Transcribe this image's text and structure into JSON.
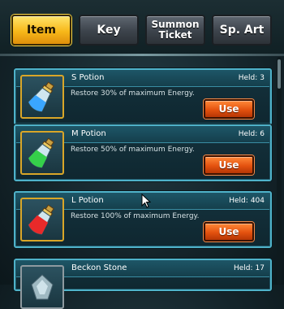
{
  "tabs": [
    {
      "label": "Item",
      "active": true
    },
    {
      "label": "Key",
      "active": false
    },
    {
      "label": "Summon Ticket",
      "active": false
    },
    {
      "label": "Sp. Art",
      "active": false
    }
  ],
  "held_label": "Held:",
  "items": [
    {
      "name": "S Potion",
      "held": "3",
      "description": "Restore 30% of maximum Energy.",
      "button": "Use",
      "icon": "blue-potion-icon",
      "liquid_color": "#3aa6ff"
    },
    {
      "name": "M Potion",
      "held": "6",
      "description": "Restore 50% of maximum Energy.",
      "button": "Use",
      "icon": "green-potion-icon",
      "liquid_color": "#35d04a"
    },
    {
      "name": "L Potion",
      "held": "404",
      "description": "Restore 100% of maximum Energy.",
      "button": "Use",
      "icon": "red-potion-icon",
      "liquid_color": "#e82a2a"
    },
    {
      "name": "Beckon Stone",
      "held": "17",
      "icon": "stone-icon"
    }
  ],
  "colors": {
    "active_tab": "#f7b81a",
    "card_border": "#4fb2c9",
    "use_button": "#e4520f",
    "icon_frame": "#d9a628"
  }
}
